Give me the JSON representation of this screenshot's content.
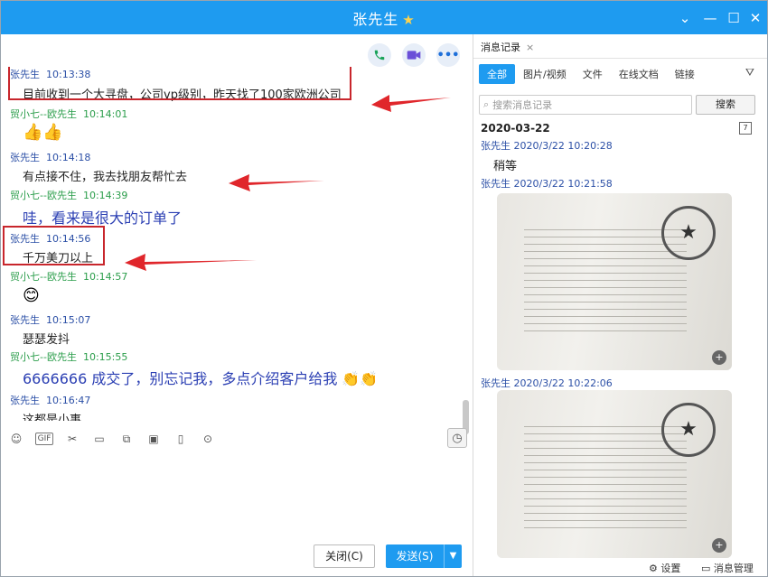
{
  "window": {
    "title": "张先生",
    "accent": "#1e9bf0"
  },
  "chat": {
    "messages": [
      {
        "sender": "张先生",
        "time": "10:13:38",
        "text": "目前收到一个大寻盘，公司vp级别，昨天找了100家欧洲公司"
      },
      {
        "sender": "贸小七--欧先生",
        "time": "10:14:01",
        "text": "👍👍"
      },
      {
        "sender": "张先生",
        "time": "10:14:18",
        "text": "有点接不住，我去找朋友帮忙去"
      },
      {
        "sender": "贸小七--欧先生",
        "time": "10:14:39",
        "text": "哇，看来是很大的订单了"
      },
      {
        "sender": "张先生",
        "time": "10:14:56",
        "text": "千万美刀以上"
      },
      {
        "sender": "贸小七--欧先生",
        "time": "10:14:57",
        "text": "😊"
      },
      {
        "sender": "张先生",
        "time": "10:15:07",
        "text": "瑟瑟发抖"
      },
      {
        "sender": "贸小七--欧先生",
        "time": "10:15:55",
        "text": "6666666  成交了，别忘记我，多点介绍客户给我 👏👏"
      },
      {
        "sender": "张先生",
        "time": "10:16:47",
        "text": "这都是小事"
      }
    ],
    "close_label": "关闭(C)",
    "send_label": "发送(S)"
  },
  "history": {
    "tab_label": "消息记录",
    "filters": [
      "全部",
      "图片/视频",
      "文件",
      "在线文档",
      "链接"
    ],
    "search_placeholder": "搜索消息记录",
    "search_button": "搜索",
    "date": "2020-03-22",
    "entries": [
      {
        "sender": "张先生",
        "datetime": "2020/3/22 10:20:28",
        "text": "稍等"
      },
      {
        "sender": "张先生",
        "datetime": "2020/3/22 10:21:58",
        "text": ""
      },
      {
        "sender": "张先生",
        "datetime": "2020/3/22 10:22:06",
        "text": ""
      }
    ],
    "settings_label": "设置",
    "manage_label": "消息管理",
    "calendar_day": "7"
  }
}
